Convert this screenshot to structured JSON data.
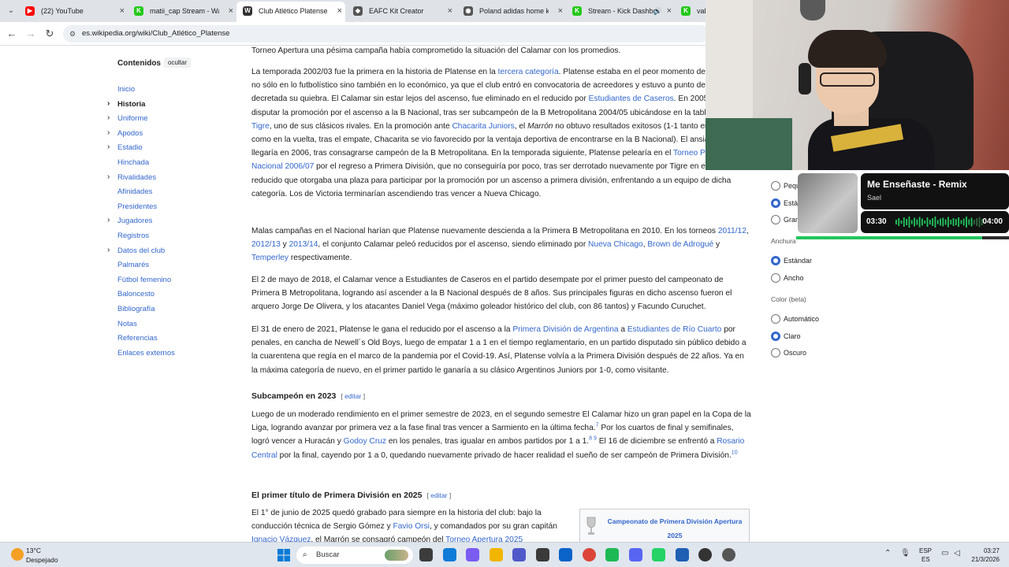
{
  "browser": {
    "tabs": [
      {
        "title": "(22) YouTube",
        "favicon": "youtube-icon",
        "color": "#ff0000",
        "glyph": "▶"
      },
      {
        "title": "matii_cap Stream - Watch",
        "favicon": "kick-icon",
        "color": "#25c81a",
        "glyph": "K"
      },
      {
        "title": "Club Atlético Platense - W",
        "favicon": "wikipedia-icon",
        "color": "#333333",
        "glyph": "W"
      },
      {
        "title": "EAFC Kit Creator",
        "favicon": "kit-creator-icon",
        "color": "#555555",
        "glyph": "◆"
      },
      {
        "title": "Poland adidas home kit -",
        "favicon": "kit-icon",
        "color": "#555555",
        "glyph": "◉"
      },
      {
        "title": "Stream - Kick Dashbo",
        "favicon": "kick-icon",
        "color": "#25c81a",
        "glyph": "K"
      },
      {
        "title": "vale",
        "favicon": "kick-icon",
        "color": "#25c81a",
        "glyph": "K"
      }
    ],
    "url": "es.wikipedia.org/wiki/Club_Atlético_Platense"
  },
  "toc": {
    "title": "Contenidos",
    "hide_label": "ocultar",
    "items": [
      {
        "label": "Inicio",
        "expandable": false,
        "current": false
      },
      {
        "label": "Historia",
        "expandable": true,
        "current": true
      },
      {
        "label": "Uniforme",
        "expandable": true,
        "current": false
      },
      {
        "label": "Apodos",
        "expandable": true,
        "current": false
      },
      {
        "label": "Estadio",
        "expandable": true,
        "current": false
      },
      {
        "label": "Hinchada",
        "expandable": false,
        "current": false
      },
      {
        "label": "Rivalidades",
        "expandable": true,
        "current": false
      },
      {
        "label": "Afinidades",
        "expandable": false,
        "current": false
      },
      {
        "label": "Presidentes",
        "expandable": false,
        "current": false
      },
      {
        "label": "Jugadores",
        "expandable": true,
        "current": false
      },
      {
        "label": "Registros",
        "expandable": false,
        "current": false
      },
      {
        "label": "Datos del club",
        "expandable": true,
        "current": false
      },
      {
        "label": "Palmarés",
        "expandable": false,
        "current": false
      },
      {
        "label": "Fútbol femenino",
        "expandable": false,
        "current": false
      },
      {
        "label": "Baloncesto",
        "expandable": false,
        "current": false
      },
      {
        "label": "Bibliografía",
        "expandable": false,
        "current": false
      },
      {
        "label": "Notas",
        "expandable": false,
        "current": false
      },
      {
        "label": "Referencias",
        "expandable": false,
        "current": false
      },
      {
        "label": "Enlaces externos",
        "expandable": false,
        "current": false
      }
    ]
  },
  "article": {
    "p0": "Torneo Apertura una pésima campaña había comprometido la situación del Calamar con los promedios.",
    "p1": [
      {
        "t": "La temporada 2002/03 fue la primera en la historia de Platense en la "
      },
      {
        "t": "tercera categoría",
        "link": true
      },
      {
        "t": ". Platense estaba en el peor momento de su historia, no sólo en lo futbolístico sino también en lo económico, ya que el club entró en convocatoria de acreedores y estuvo a punto de ser decretada su quiebra. El Calamar sin estar lejos del ascenso, fue eliminado en el reducido por "
      },
      {
        "t": "Estudiantes de Caseros",
        "link": true
      },
      {
        "t": ". En 2005, accedió a disputar la promoción por el ascenso a la B Nacional, tras ser subcampeón de la B Metropolitana 2004/05 ubicándose en la tabla detrás de "
      },
      {
        "t": "Tigre",
        "link": true
      },
      {
        "t": ", uno de sus clásicos rivales. En la promoción ante "
      },
      {
        "t": "Chacarita Juniors",
        "link": true
      },
      {
        "t": ", el "
      },
      {
        "t": "Marrón",
        "italic": true
      },
      {
        "t": " no obtuvo resultados exitosos (1-1 tanto en la ida como en la vuelta, tras el empate, Chacarita se vio favorecido por la ventaja deportiva de encontrarse en la B Nacional). El ansiado ascenso llegaría en 2006, tras consagrarse campeón de la B Metropolitana. En la temporada siguiente, Platense pelearía en el "
      },
      {
        "t": "Torneo Primera B Nacional 2006/07",
        "link": true
      },
      {
        "t": " por el regreso a Primera División, que no conseguiría por poco, tras ser derrotado nuevamente por Tigre en el torneo reducido que otorgaba una plaza para participar por la promoción por un ascenso a primera división, enfrentando a un equipo de dicha categoría. Los de Victoria terminarían ascendiendo tras vencer a Nueva Chicago."
      }
    ],
    "p2": [
      {
        "t": "Malas campañas en el Nacional harían que Platense nuevamente descienda a la Primera B Metropolitana en 2010. En los torneos "
      },
      {
        "t": "2011/12",
        "link": true
      },
      {
        "t": ", "
      },
      {
        "t": "2012/13",
        "link": true
      },
      {
        "t": " y "
      },
      {
        "t": "2013/14",
        "link": true
      },
      {
        "t": ", el conjunto Calamar peleó reducidos por el ascenso, siendo eliminado por "
      },
      {
        "t": "Nueva Chicago",
        "link": true
      },
      {
        "t": ", "
      },
      {
        "t": "Brown de Adrogué",
        "link": true
      },
      {
        "t": " y "
      },
      {
        "t": "Temperley",
        "link": true
      },
      {
        "t": " respectivamente."
      }
    ],
    "p3": "El 2 de mayo de 2018, el Calamar vence a Estudiantes de Caseros en el partido desempate por el primer puesto del campeonato de Primera B Metropolitana, logrando así ascender a la B Nacional después de 8 años. Sus principales figuras en dicho ascenso fueron el arquero Jorge De Olivera, y los atacantes Daniel Vega (máximo goleador histórico del club, con 86 tantos) y Facundo Curuchet.",
    "p4": [
      {
        "t": "El 31 de enero de 2021, Platense le gana el reducido por el ascenso a la "
      },
      {
        "t": "Primera División de Argentina",
        "link": true
      },
      {
        "t": " a "
      },
      {
        "t": "Estudiantes de Río Cuarto",
        "link": true
      },
      {
        "t": " por penales, en cancha de Newell´s Old Boys, luego de empatar 1 a 1 en el tiempo reglamentario, en un partido disputado sin público debido a la cuarentena que regía en el marco de la pandemia por el Covid-19. Así, Platense volvía a la Primera División después de 22 años. Ya en la máxima categoría de nuevo, en el primer partido le ganaría a su clásico Argentinos Juniors por 1-0, como visitante."
      }
    ],
    "h_subcampeon": "Subcampeón en 2023",
    "edit_label": "editar",
    "p5": [
      {
        "t": "Luego de un moderado rendimiento en el primer semestre de 2023, en el segundo semestre El Calamar hizo un gran papel en la Copa de la Liga, logrando avanzar por primera vez a la fase final tras vencer a Sarmiento en la última fecha."
      },
      {
        "t": "7",
        "sup": true
      },
      {
        "t": " Por los cuartos de final y semifinales, logró vencer a Huracán y "
      },
      {
        "t": "Godoy Cruz",
        "link": true
      },
      {
        "t": " en los penales, tras igualar en ambos partidos por 1 a 1."
      },
      {
        "t": "8 9",
        "sup": true
      },
      {
        "t": " El 16 de diciembre se enfrentó a "
      },
      {
        "t": "Rosario Central",
        "link": true
      },
      {
        "t": " por la final, cayendo por 1 a 0, quedando nuevamente privado de hacer realidad el sueño de ser campeón de Primera División."
      },
      {
        "t": "10",
        "sup": true
      }
    ],
    "h_titulo": "El primer título de Primera División en 2025",
    "p6": [
      {
        "t": "El 1° de junio de 2025 quedó grabado para siempre en la historia del club: bajo la conducción técnica de Sergio Gómez y "
      },
      {
        "t": "Favio Orsi",
        "link": true
      },
      {
        "t": ", y comandados por su gran capitán "
      },
      {
        "t": "Ignacio Vázquez",
        "link": true
      },
      {
        "t": ", el Marrón se consagró campeón del "
      },
      {
        "t": "Torneo Apertura 2025",
        "link": true
      }
    ],
    "infobox_title": "Campeonato de Primera División Apertura 2025"
  },
  "appearance": {
    "text_options": [
      "Pequeño",
      "Estándar",
      "Grande"
    ],
    "width_label": "Anchura",
    "width_options": [
      "Estándar",
      "Ancho"
    ],
    "color_label": "Color (beta)",
    "color_options": [
      "Automático",
      "Claro",
      "Oscuro"
    ]
  },
  "music": {
    "title": "Me Enseñaste - Remix",
    "artist": "Sael",
    "elapsed": "03:30",
    "total": "04:00",
    "progress": 0.875,
    "accent": "#22c55e"
  },
  "taskbar": {
    "temperature": "13°C",
    "weather": "Despejado",
    "search_placeholder": "Buscar",
    "apps": [
      "task-view-icon",
      "edge-icon",
      "copilot-icon",
      "file-explorer-icon",
      "teams-icon",
      "store-icon",
      "mail-icon",
      "chrome-icon",
      "spotify-icon",
      "discord-icon",
      "whatsapp-icon",
      "defender-icon",
      "obs-icon",
      "settings-icon"
    ],
    "lang_line1": "ESP",
    "lang_line2": "ES",
    "time": "03:27",
    "date": "21/3/2026"
  }
}
